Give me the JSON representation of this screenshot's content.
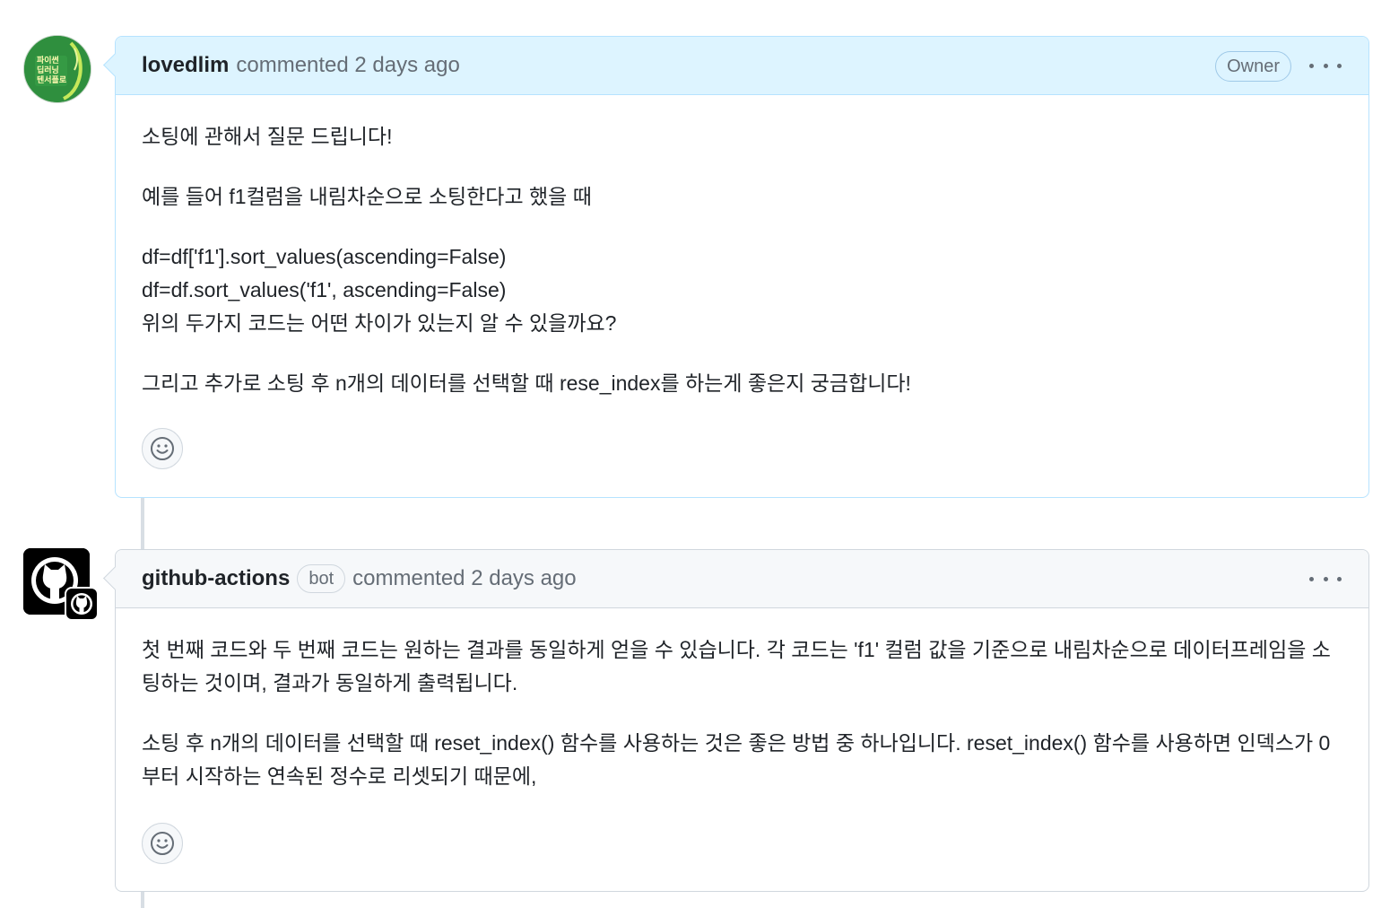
{
  "comments": [
    {
      "author": "lovedlim",
      "meta": "commented 2 days ago",
      "role": "Owner",
      "avatar_icon": "book-cover-avatar",
      "avatar_text": "파이썬\n딥러닝\n텐서플로",
      "paragraphs": [
        "소팅에 관해서 질문 드립니다!",
        "예를 들어 f1컬럼을 내림차순으로 소팅한다고 했을 때",
        "df=df['f1'].sort_values(ascending=False)\ndf=df.sort_values('f1', ascending=False)\n위의 두가지 코드는 어떤 차이가 있는지 알 수 있을까요?",
        "그리고 추가로 소팅 후 n개의 데이터를 선택할 때 rese_index를 하는게 좋은지 궁금합니다!"
      ]
    },
    {
      "author": "github-actions",
      "bot_label": "bot",
      "meta": "commented 2 days ago",
      "avatar_icon": "github-octocat-icon",
      "paragraphs": [
        "첫 번째 코드와 두 번째 코드는 원하는 결과를 동일하게 얻을 수 있습니다. 각 코드는 'f1' 컬럼 값을 기준으로 내림차순으로 데이터프레임을 소팅하는 것이며, 결과가 동일하게 출력됩니다.",
        "소팅 후 n개의 데이터를 선택할 때 reset_index() 함수를 사용하는 것은 좋은 방법 중 하나입니다. reset_index() 함수를 사용하면 인덱스가 0부터 시작하는 연속된 정수로 리셋되기 때문에,"
      ]
    }
  ],
  "colors": {
    "owner_header_bg": "#ddf4ff",
    "default_header_bg": "#f6f8fa",
    "border": "#d0d7de",
    "muted_text": "#656d76"
  }
}
